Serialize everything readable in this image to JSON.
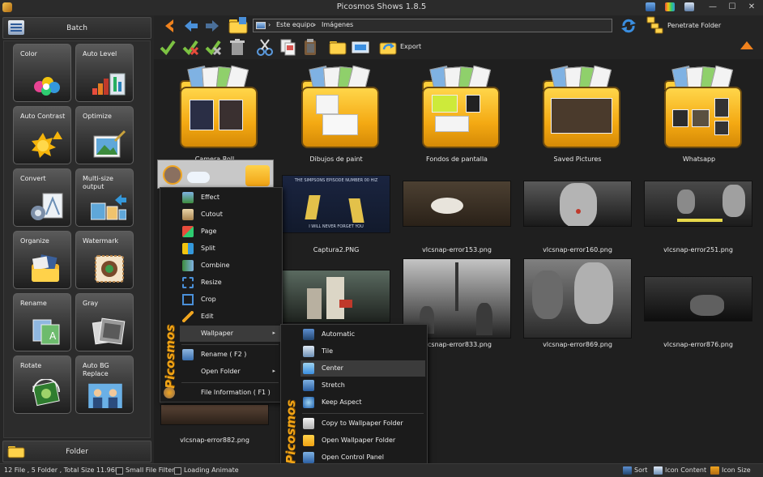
{
  "window": {
    "title": "Picosmos Shows 1.8.5",
    "controls": {
      "minimize": "—",
      "maximize": "☐",
      "close": "✕"
    }
  },
  "left_panel": {
    "batch_label": "Batch",
    "folder_label": "Folder",
    "tools": [
      {
        "label": "Color",
        "icon": "color-wheel-icon"
      },
      {
        "label": "Auto Level",
        "icon": "bar-chart-icon"
      },
      {
        "label": "Auto Contrast",
        "icon": "sun-contrast-icon"
      },
      {
        "label": "Optimize",
        "icon": "optimize-picture-icon"
      },
      {
        "label": "Convert",
        "icon": "convert-icon"
      },
      {
        "label": "Multi-size output",
        "icon": "multi-size-icon"
      },
      {
        "label": "Organize",
        "icon": "organize-folder-icon"
      },
      {
        "label": "Watermark",
        "icon": "watermark-icon"
      },
      {
        "label": "Rename",
        "icon": "rename-icon"
      },
      {
        "label": "Gray",
        "icon": "gray-photos-icon"
      },
      {
        "label": "Rotate",
        "icon": "rotate-icon"
      },
      {
        "label": "Auto BG Replace",
        "icon": "bg-replace-icon"
      }
    ]
  },
  "toolbar": {
    "breadcrumb": [
      "Este equipo",
      "Imágenes"
    ],
    "separator": "›",
    "penetrate_folder": "Penetrate Folder",
    "export_label": "Export",
    "accent": "#f0821d"
  },
  "content": {
    "folders": [
      {
        "name": "Camera Roll"
      },
      {
        "name": "Dibujos de paint"
      },
      {
        "name": "Fondos de pantalla"
      },
      {
        "name": "Saved Pictures"
      },
      {
        "name": "Whatsapp"
      }
    ],
    "files": [
      {
        "name": "Captura2.PNG",
        "thumb_text": "THE SIMPSONS EPISODE NUMBER 00 HIZ",
        "thumb_text2": "I WILL NEVER FORGET YOU"
      },
      {
        "name": "vlcsnap-error153.png"
      },
      {
        "name": "vlcsnap-error160.png"
      },
      {
        "name": "vlcsnap-error251.png"
      },
      {
        "name": "vlcsnap-error833.png"
      },
      {
        "name": "vlcsnap-error869.png"
      },
      {
        "name": "vlcsnap-error876.png"
      },
      {
        "name": "vlcsnap-error882.png"
      }
    ]
  },
  "context_menu": {
    "brand": "Picosmos",
    "items": [
      {
        "label": "Effect",
        "icon": "effect-icon"
      },
      {
        "label": "Cutout",
        "icon": "cutout-icon"
      },
      {
        "label": "Page",
        "icon": "page-icon"
      },
      {
        "label": "Split",
        "icon": "split-icon"
      },
      {
        "label": "Combine",
        "icon": "combine-icon"
      },
      {
        "label": "Resize",
        "icon": "resize-icon"
      },
      {
        "label": "Crop",
        "icon": "crop-icon"
      },
      {
        "label": "Edit",
        "icon": "edit-pencil-icon"
      },
      {
        "label": "Wallpaper",
        "icon": "",
        "submenu": "▸"
      },
      {
        "label": "Rename ( F2 )",
        "icon": "rename-icon"
      },
      {
        "label": "Open Folder",
        "icon": "",
        "submenu": "▸"
      },
      {
        "label": "File Information ( F1 )",
        "icon": "info-icon"
      }
    ]
  },
  "wallpaper_menu": {
    "brand": "Picosmos",
    "items": [
      {
        "label": "Automatic",
        "icon": "wallpaper-auto-icon"
      },
      {
        "label": "Tile",
        "icon": "wallpaper-tile-icon"
      },
      {
        "label": "Center",
        "icon": "wallpaper-center-icon"
      },
      {
        "label": "Stretch",
        "icon": "wallpaper-stretch-icon"
      },
      {
        "label": "Keep Aspect",
        "icon": "wallpaper-keep-aspect-icon"
      },
      {
        "label": "Copy to Wallpaper Folder",
        "icon": "copy-icon"
      },
      {
        "label": "Open Wallpaper Folder",
        "icon": "folder-icon"
      },
      {
        "label": "Open Control Panel",
        "icon": "control-panel-icon"
      }
    ],
    "highlighted": "Center"
  },
  "status_bar": {
    "summary": "12 File , 5 Folder , Total Size 11.96M",
    "small_file_filter": "Small File Filter",
    "loading_animate": "Loading Animate",
    "sort": "Sort",
    "icon_content": "Icon Content",
    "icon_size": "Icon Size"
  }
}
